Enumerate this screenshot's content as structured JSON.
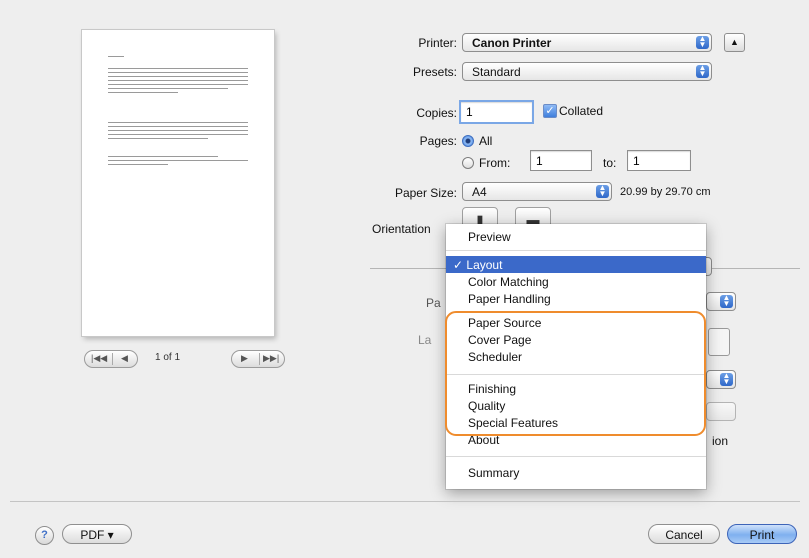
{
  "preview": {
    "nav_first": "|◀◀",
    "nav_prev": "◀",
    "page_indicator": "1 of 1",
    "nav_next": "▶",
    "nav_last": "▶▶|"
  },
  "printer": {
    "label": "Printer:",
    "value": "Canon Printer"
  },
  "presets": {
    "label": "Presets:",
    "value": "Standard"
  },
  "copies": {
    "label": "Copies:",
    "value": "1",
    "collated_label": "Collated",
    "collated_checked": true
  },
  "pages": {
    "label": "Pages:",
    "all_label": "All",
    "from_label": "From:",
    "from_value": "1",
    "to_label": "to:",
    "to_value": "1"
  },
  "paper_size": {
    "label": "Paper Size:",
    "value": "A4",
    "dimensions": "20.99 by 29.70 cm"
  },
  "orientation": {
    "label": "Orientation"
  },
  "menu": {
    "items_top": [
      "Preview"
    ],
    "selected": "Layout",
    "items_mid": [
      "Color Matching",
      "Paper Handling",
      "Paper Source",
      "Cover Page",
      "Scheduler"
    ],
    "items_group2": [
      "Finishing",
      "Quality",
      "Special Features",
      "About"
    ],
    "items_bottom": [
      "Summary"
    ],
    "highlight_color": "#ef8c2d"
  },
  "footer": {
    "help": "?",
    "pdf": "PDF ▾",
    "cancel": "Cancel",
    "print": "Print"
  },
  "ghost": {
    "pa": "Pa",
    "la": "La",
    "ion": "ion"
  }
}
